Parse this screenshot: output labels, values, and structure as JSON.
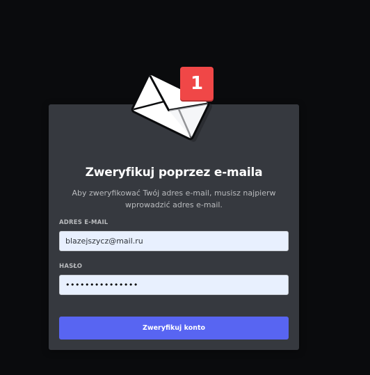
{
  "illustration": {
    "icon": "envelope-icon",
    "badge_count": "1",
    "badge_color": "#f04747"
  },
  "card": {
    "title": "Zweryfikuj poprzez e-maila",
    "subtitle": "Aby zweryfikować Twój adres e-mail, musisz najpierw wprowadzić adres e-mail."
  },
  "form": {
    "email_label": "ADRES E-MAIL",
    "email_value": "blazejszycz@mail.ru",
    "password_label": "HASŁO",
    "password_value": "•••••••••••••••",
    "submit_label": "Zweryfikuj konto"
  },
  "colors": {
    "background": "#0a0b0d",
    "card": "#36393f",
    "accent": "#5865f2",
    "input_background": "#e8f0fe"
  }
}
